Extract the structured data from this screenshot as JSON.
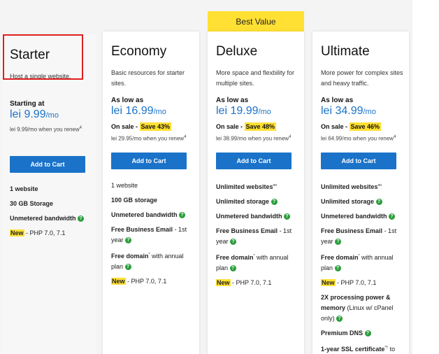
{
  "badge": "Best Value",
  "cart_label": "Add to Cart",
  "plans": [
    {
      "name": "Starter",
      "desc": "Host a single website.",
      "price_label": "Starting at",
      "price": "lei 9.99",
      "unit": "/mo",
      "renew": "lei 9.99/mo when you renew",
      "renew_sup": "4",
      "features": [
        "1 website",
        "30 GB Storage",
        "Unmetered bandwidth",
        "New",
        "- PHP 7.0, 7.1"
      ]
    },
    {
      "name": "Economy",
      "desc": "Basic resources for starter sites.",
      "price_label": "As low as",
      "price": "lei 16.99",
      "unit": "/mo",
      "sale": "On sale - ",
      "save": "Save 43%",
      "renew": "lei 29.95/mo when you renew",
      "renew_sup": "4",
      "features": [
        "1 website",
        "100 GB storage",
        "Unmetered bandwidth",
        "Free Business Email",
        "- 1st year",
        "Free domain",
        "with annual plan",
        "New",
        "- PHP 7.0, 7.1"
      ]
    },
    {
      "name": "Deluxe",
      "desc": "More space and flexbility for multiple sites.",
      "price_label": "As low as",
      "price": "lei 19.99",
      "unit": "/mo",
      "sale": "On sale - ",
      "save": "Save 48%",
      "renew": "lei 38.99/mo when you renew",
      "renew_sup": "4",
      "features": [
        "Unlimited websites",
        "Unlimited storage",
        "Unmetered bandwidth",
        "Free Business Email",
        "- 1st year",
        "Free domain",
        "with annual plan",
        "New",
        "- PHP 7.0, 7.1"
      ]
    },
    {
      "name": "Ultimate",
      "desc": "More power for complex sites and heavy traffic.",
      "price_label": "As low as",
      "price": "lei 34.99",
      "unit": "/mo",
      "sale": "On sale - ",
      "save": "Save 46%",
      "renew": "lei 64.99/mo when you renew",
      "renew_sup": "4",
      "features": [
        "Unlimited websites",
        "Unlimited storage",
        "Unmetered bandwidth",
        "Free Business Email",
        "- 1st year",
        "Free domain",
        "with annual plan",
        "New",
        "- PHP 7.0, 7.1",
        "2X processing power & memory",
        "(Linux w/ cPanel only)",
        "Premium DNS",
        "1-year SSL certificate",
        "to"
      ]
    }
  ],
  "colors": {
    "accent": "#1a73c9",
    "highlight": "#ffe033",
    "check": "#2a9d3a",
    "selection": "#e01e1e"
  }
}
